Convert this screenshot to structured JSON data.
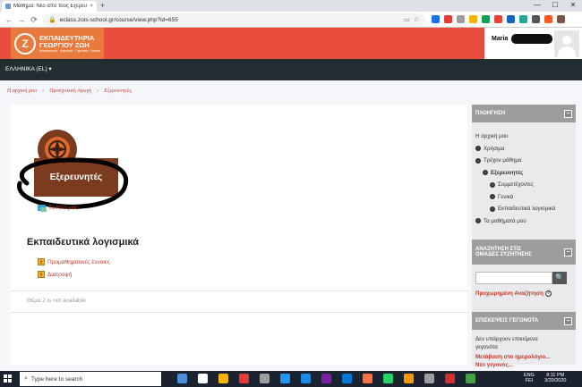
{
  "browser": {
    "tab_title": "Μάθημα: Νέο από τους Εξερευ...",
    "tab_close": "×",
    "new_tab": "+",
    "window_min": "—",
    "window_max": "☐",
    "window_close": "✕",
    "back": "←",
    "forward": "→",
    "reload": "⟳",
    "url": "eclass.zois-school.gr/course/view.php?id=655",
    "extension_colors": [
      "#1a73e8",
      "#e53935",
      "#9e9e9e",
      "#f4b400",
      "#0f9d58",
      "#ea4335",
      "#1565c0",
      "#26a69a",
      "#555555",
      "#ff5722",
      "#795548"
    ]
  },
  "header": {
    "logo_line1": "ΕΚΠΑΙΔΕΥΤΗΡΙΑ",
    "logo_line2": "ΓΕΩΡΓΙΟΥ ΖΩΗ",
    "logo_sub": "Νηπιαγωγείο · Δημοτικό · Γυμνάσιο · Λύκειο",
    "logo_mark": "Ζ",
    "username": "Maria"
  },
  "langbar": {
    "language": "ΕΛΛΗΝΙΚΑ (EL) ▾"
  },
  "breadcrumb": [
    "Η αρχική μου",
    "Προσχολική Αγωγή",
    "Εξερευνητές"
  ],
  "breadcrumb_sep": "›",
  "main": {
    "course_banner": "Εξερευνητές",
    "forum_link": "Τα Νέα μας",
    "section_title": "Εκπαιδευτικά λογισμικά",
    "activities": [
      "Προμαθηματικές έννοιες",
      "Διατροφή"
    ],
    "unavailable": "Θέμα 2 is not available"
  },
  "sidebar": {
    "nav_title": "ΠΛΟΗΓΗΣΗ",
    "collapse": "−",
    "nav": [
      {
        "label": "Η αρχική μου",
        "bullet": false,
        "bold": false
      },
      {
        "label": "Χρήσιμα",
        "bullet": true,
        "bold": false
      },
      {
        "label": "Τρέχον μάθημα",
        "bullet": true,
        "bold": false
      },
      {
        "label": "Εξερευνητές",
        "bullet": true,
        "bold": true
      },
      {
        "label": "Συμμετέχοντες",
        "bullet": true,
        "bold": false
      },
      {
        "label": "Γενικά",
        "bullet": true,
        "bold": false
      },
      {
        "label": "Εκπαιδευτικά λογισμικά",
        "bullet": true,
        "bold": false
      },
      {
        "label": "Τα μαθήματά μου",
        "bullet": true,
        "bold": false
      }
    ],
    "search_title_1": "ΑΝΑΖΗΤΗΣΗ ΣΤΙΣ",
    "search_title_2": "ΟΜΑΔΕΣ ΣΥΖΗΤΗΣΗΣ",
    "search_button": "🔍",
    "advanced_search": "Προχωρημένη Αναζήτηση",
    "help": "?",
    "events_title": "ΕΠΙΣΚΕΨΕΙΣ ΓΕΓΟΝΟΤΑ",
    "events_none_1": "Δεν υπάρχουν επικείμενα",
    "events_none_2": "γεγονότα",
    "goto_calendar": "Μετάβαση στο ημερολόγιο...",
    "new_event": "Νέο γεγονός..."
  },
  "taskbar": {
    "search_icon": "⌕",
    "search_placeholder": "Type here to search",
    "app_colors": [
      "#4a90d9",
      "#ffffff",
      "#f4b400",
      "#e53935",
      "#9e9e9e",
      "#2196f3",
      "#1e88e5",
      "#7b1fa2",
      "#0078d7",
      "#ff7043",
      "#25d366",
      "#ff9800",
      "#9e9e9e",
      "#d32f2f",
      "#43a047"
    ],
    "lang_1": "ENG",
    "lang_2": "FEI",
    "time": "8:11 PM",
    "date": "3/20/2020"
  }
}
